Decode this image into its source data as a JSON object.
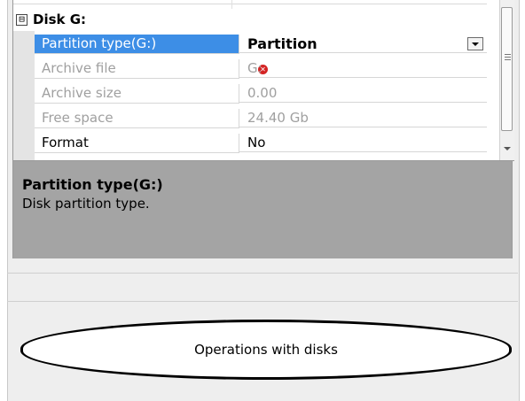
{
  "category": {
    "toggle": "⊟",
    "label": "Disk G:"
  },
  "properties": [
    {
      "name": "Partition type(G:)",
      "value": "Partition"
    },
    {
      "name": "Archive file",
      "value": "G:"
    },
    {
      "name": "Archive size",
      "value": "0.00"
    },
    {
      "name": "Free space",
      "value": "24.40 Gb"
    },
    {
      "name": "Format",
      "value": "No"
    }
  ],
  "icons": {
    "edit": "pencil-icon",
    "error": "error-icon",
    "dropdown": "chevron-down-icon"
  },
  "description": {
    "title": "Partition type(G:)",
    "text": "Disk partition type."
  },
  "operations_button": {
    "label": "Operations with disks"
  },
  "colors": {
    "selection": "#3d8ee6",
    "description_bg": "#a4a4a4",
    "error": "#d42424"
  }
}
